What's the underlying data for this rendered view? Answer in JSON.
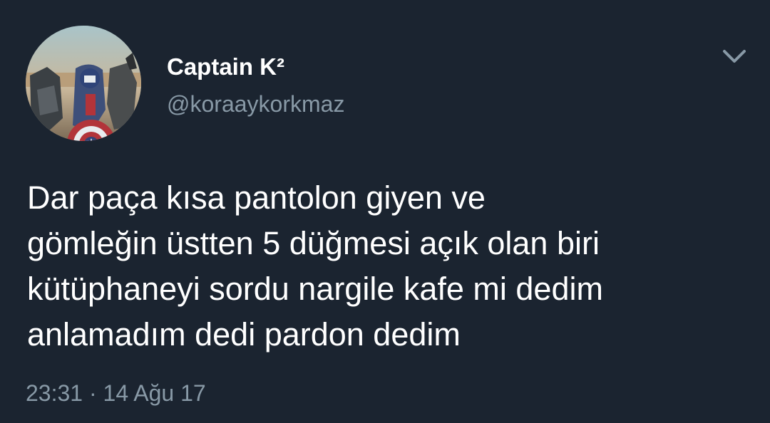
{
  "user": {
    "display_name": "Captain K²",
    "handle": "@koraaykorkmaz",
    "avatar": "profile-photo"
  },
  "tweet": {
    "lines": [
      "Dar paça kısa pantolon giyen ve",
      "gömleğin üstten 5 düğmesi açık olan biri",
      "kütüphaneyi sordu nargile kafe mi dedim",
      "anlamadım dedi pardon dedim"
    ],
    "timestamp": "23:31 · 14 Ağu 17"
  },
  "icons": {
    "menu": "chevron-down-icon"
  },
  "colors": {
    "background": "#1b2430",
    "primary_text": "#ffffff",
    "secondary_text": "#8899a6"
  }
}
